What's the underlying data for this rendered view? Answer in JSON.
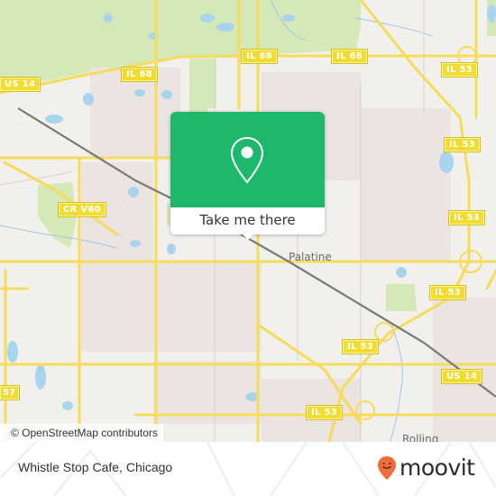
{
  "map": {
    "attribution": "© OpenStreetMap contributors",
    "place_labels": {
      "palatine": "Palatine",
      "rolling": "Rolling"
    },
    "shields": {
      "us14_west": "US 14",
      "il68_west": "IL 68",
      "il68_mid": "IL 68",
      "il68_east": "IL 68",
      "il53_north": "IL 53",
      "il53_a": "IL 53",
      "il53_b": "IL 53",
      "il53_c": "IL 53",
      "il53_d": "IL 53",
      "il53_e": "IL 53",
      "il53_south": "IL 53",
      "us14_east": "US 14",
      "crv60": "CR V60",
      "r57": "57"
    },
    "colors": {
      "land": "#f2f0ec",
      "residential": "#ebe4e1",
      "park": "#d5e8b8",
      "water": "#a8d4ee",
      "road": "#f5dc5a",
      "railway": "#777777"
    }
  },
  "popup": {
    "icon": "map-pin-icon",
    "button_label": "Take me there",
    "color": "#1db86b"
  },
  "footer": {
    "place_name": "Whistle Stop Cafe, Chicago",
    "brand_name": "moovit",
    "brand_color": "#f26b3a"
  }
}
